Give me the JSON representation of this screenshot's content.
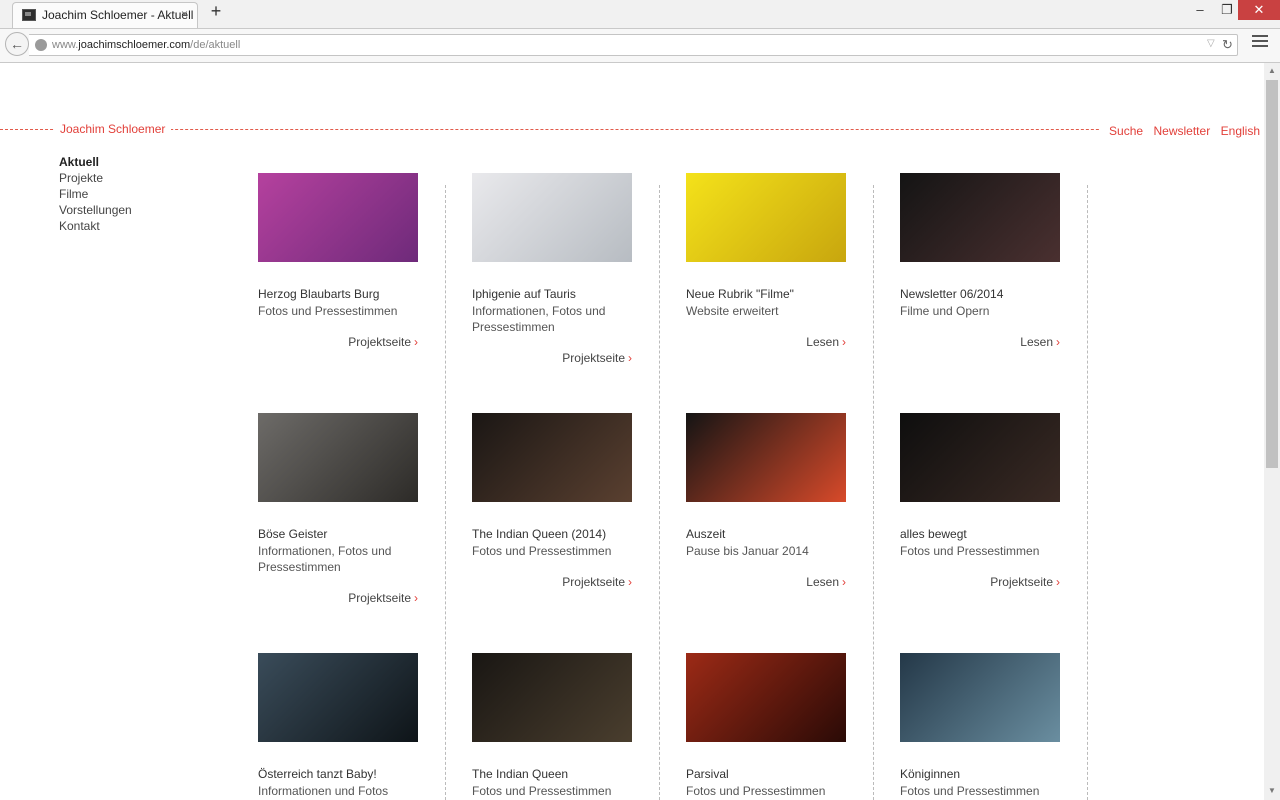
{
  "browser": {
    "tab_title": "Joachim Schloemer - Aktuell",
    "tab_close": "×",
    "new_tab": "+",
    "win_min": "–",
    "win_max": "❐",
    "win_close": "✕",
    "url_prefix": "www.",
    "url_domain": "joachimschloemer.com",
    "url_path": "/de/aktuell"
  },
  "site": {
    "title": "Joachim Schloemer",
    "topnav": [
      "Suche",
      "Newsletter",
      "English"
    ],
    "sidebar": [
      {
        "label": "Aktuell",
        "active": true
      },
      {
        "label": "Projekte",
        "active": false
      },
      {
        "label": "Filme",
        "active": false
      },
      {
        "label": "Vorstellungen",
        "active": false
      },
      {
        "label": "Kontakt",
        "active": false
      }
    ]
  },
  "cards": [
    {
      "title": "Herzog Blaubarts Burg",
      "subtitle": "Fotos und Pressestimmen",
      "link": "Projektseite",
      "image": "red-figure-pink-stage",
      "colors": [
        "#b5419e",
        "#6e2a7a"
      ]
    },
    {
      "title": "Iphigenie auf Tauris",
      "subtitle": "Informationen, Fotos und Pressestimmen",
      "link": "Projektseite",
      "image": "woman-in-white-sitting",
      "colors": [
        "#e9e9ec",
        "#b7bcc2"
      ]
    },
    {
      "title": "Neue Rubrik \"Filme\"",
      "subtitle": "Website erweitert",
      "link": "Lesen",
      "image": "woman-yellow-wall",
      "colors": [
        "#f4e21a",
        "#c8a60e"
      ]
    },
    {
      "title": "Newsletter 06/2014",
      "subtitle": "Filme und Opern",
      "link": "Lesen",
      "image": "dancers-dark-stage",
      "colors": [
        "#141414",
        "#4a3030"
      ]
    },
    {
      "title": "Böse Geister",
      "subtitle": "Informationen, Fotos und Pressestimmen",
      "link": "Projektseite",
      "image": "faces-in-boxes",
      "colors": [
        "#6d6b68",
        "#2d2b28"
      ]
    },
    {
      "title": "The Indian Queen (2014)",
      "subtitle": "Fotos und Pressestimmen",
      "link": "Projektseite",
      "image": "woman-and-bear",
      "colors": [
        "#1a1614",
        "#5a4030"
      ]
    },
    {
      "title": "Auszeit",
      "subtitle": "Pause bis Januar 2014",
      "link": "Lesen",
      "image": "clowns",
      "colors": [
        "#141414",
        "#d84a2a"
      ]
    },
    {
      "title": "alles bewegt",
      "subtitle": "Fotos und Pressestimmen",
      "link": "Projektseite",
      "image": "man-in-tuxedo",
      "colors": [
        "#0e0e0e",
        "#3a2a24"
      ]
    },
    {
      "title": "Österreich tanzt Baby!",
      "subtitle": "Informationen und Fotos",
      "link": "",
      "image": "man-in-porthole",
      "colors": [
        "#3a4c5a",
        "#0e1418"
      ]
    },
    {
      "title": "The Indian Queen",
      "subtitle": "Fotos und Pressestimmen",
      "link": "",
      "image": "man-in-rain-hat",
      "colors": [
        "#191613",
        "#4a3e2e"
      ]
    },
    {
      "title": "Parsival",
      "subtitle": "Fotos und Pressestimmen",
      "link": "",
      "image": "man-with-spear",
      "colors": [
        "#9c2a16",
        "#2a0a06"
      ]
    },
    {
      "title": "Königinnen",
      "subtitle": "Fotos und Pressestimmen",
      "link": "",
      "image": "upside-down-face",
      "colors": [
        "#243848",
        "#6a8ea0"
      ]
    }
  ],
  "icons": {
    "back": "back-arrow-icon",
    "globe": "globe-icon",
    "reload": "reload-icon",
    "menu": "hamburger-menu-icon",
    "link_arrow": "›"
  },
  "colors": {
    "accent": "#e2403a",
    "text": "#333333"
  }
}
